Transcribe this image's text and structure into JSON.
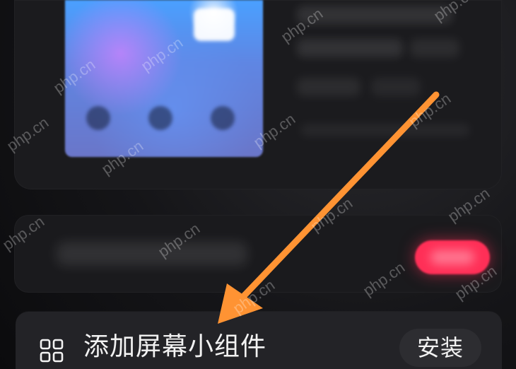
{
  "ui": {
    "add_widget_label": "添加屏幕小组件",
    "install_button_label": "安装"
  },
  "watermark": {
    "text": "php.cn"
  },
  "colors": {
    "page_bg": "#0b0b0d",
    "card_bg": "#1b1b1e",
    "bottom_row_bg": "#232327",
    "accent_red": "#ff2f57",
    "arrow_orange": "#ff9333",
    "text_primary": "#f2f2f2"
  },
  "icons": {
    "grid": "grid-icon",
    "arrow": "arrow-annotation"
  }
}
